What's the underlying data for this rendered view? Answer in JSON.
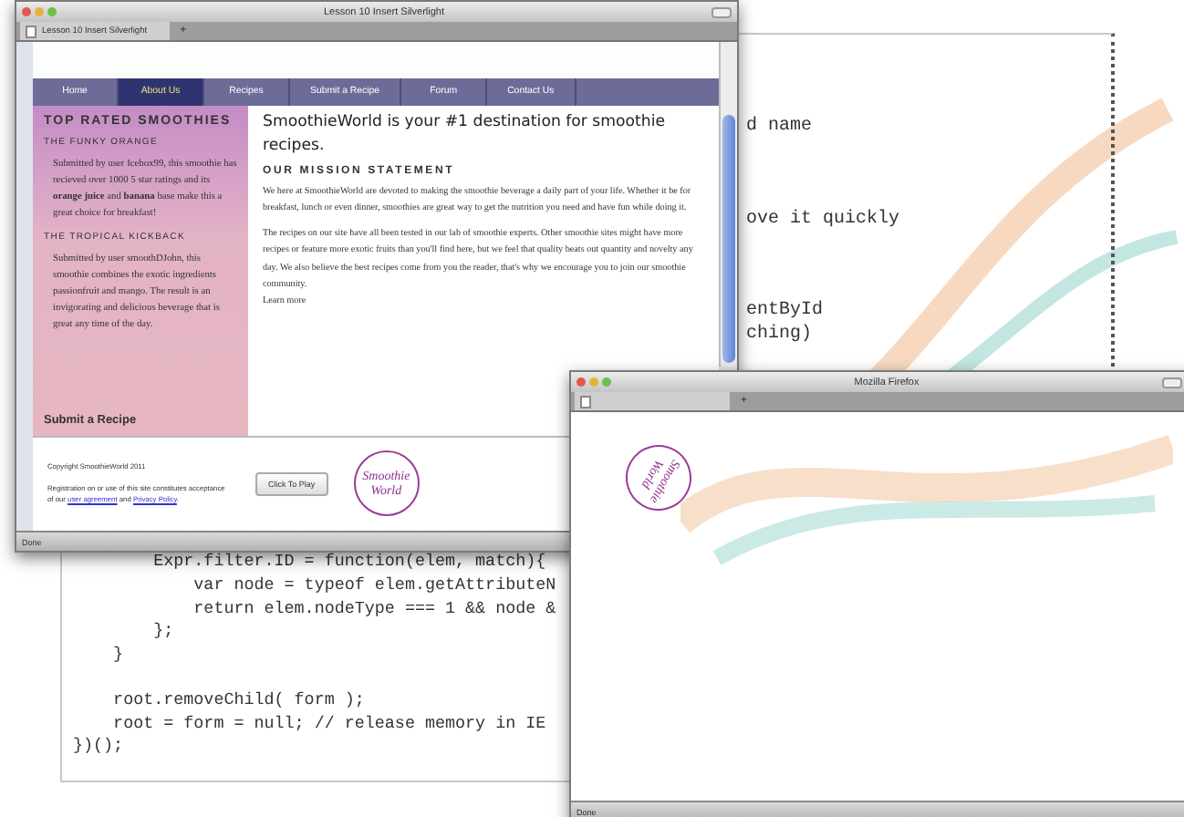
{
  "code_panel": {
    "fragment_blocks": [
      {
        "lines": [
          "d name"
        ]
      },
      {
        "lines": [
          "ove it quickly"
        ]
      },
      {
        "lines": [
          "entById",
          "ching)"
        ]
      }
    ],
    "code_blocks": [
      {
        "lines": [
          "        Expr.filter.ID = function(elem, match){",
          "            var node = typeof elem.getAttributeN",
          "            return elem.nodeType === 1 && node &",
          "        };",
          "    }"
        ]
      },
      {
        "lines": [
          "    root.removeChild( form );",
          "    root = form = null; // release memory in IE",
          "})();"
        ]
      }
    ]
  },
  "browser_window": {
    "title": "Lesson 10 Insert Silverlight",
    "tab": "Lesson 10 Insert Silverlight",
    "new_tab": "+",
    "nav": [
      {
        "label": "Home",
        "selected": false
      },
      {
        "label": "About Us",
        "selected": true
      },
      {
        "label": "Recipes",
        "selected": false
      },
      {
        "label": "Submit a Recipe",
        "selected": false
      },
      {
        "label": "Forum",
        "selected": false
      },
      {
        "label": "Contact Us",
        "selected": false
      }
    ],
    "sidebar": {
      "title": "TOP RATED SMOOTHIES",
      "entries": [
        {
          "heading": "THE FUNKY ORANGE",
          "text": "Submitted by user Icebox99, this smoothie has recieved over 1000 5 star ratings and its **orange juice** and **banana** base make this a great choice for breakfast!"
        },
        {
          "heading": "THE TROPICAL KICKBACK",
          "text": "Submitted by user smoothDJohn, this smoothie combines the exotic ingredients passionfruit and mango. The result is an invigorating and delicious beverage that is great any time of the day."
        }
      ],
      "link": "Submit a Recipe"
    },
    "main": {
      "heading": "SmoothieWorld is your #1 destination for smoothie recipes.",
      "subheading": "OUR MISSION STATEMENT",
      "paragraphs": [
        "We here at SmoothieWorld are devoted to making the smoothie beverage a daily part of your life. Whether it be for breakfast, lunch or even dinner, smoothies are great way to get the nutrition you need and have fun while doing it.",
        "The recipes on our site have all been tested in our lab of smoothie experts. Other smoothie sites might have more recipes or feature more exotic fruits than you'll find here, but we feel that quality beats out quantity and novelty any day. We also believe the best recipes come from you the reader, that's why we encourage you to join our smoothie community."
      ],
      "link": "Learn more"
    },
    "footer": {
      "copyright": "Copyright SmoothieWorld 2011",
      "legal_before": "Registration on or use of this site constitutes acceptance of our",
      "legal_link_1": "user agreement",
      "legal_middle": "and",
      "legal_link_2": "Privacy Policy",
      "legal_after": ".",
      "button": "Click To Play",
      "logo": [
        "Smoothie",
        "World"
      ]
    },
    "status": "Done"
  },
  "firefox_window": {
    "title": "Mozilla Firefox",
    "new_tab": "+",
    "logo": [
      "Smoothie",
      "World"
    ],
    "status": "Done"
  }
}
